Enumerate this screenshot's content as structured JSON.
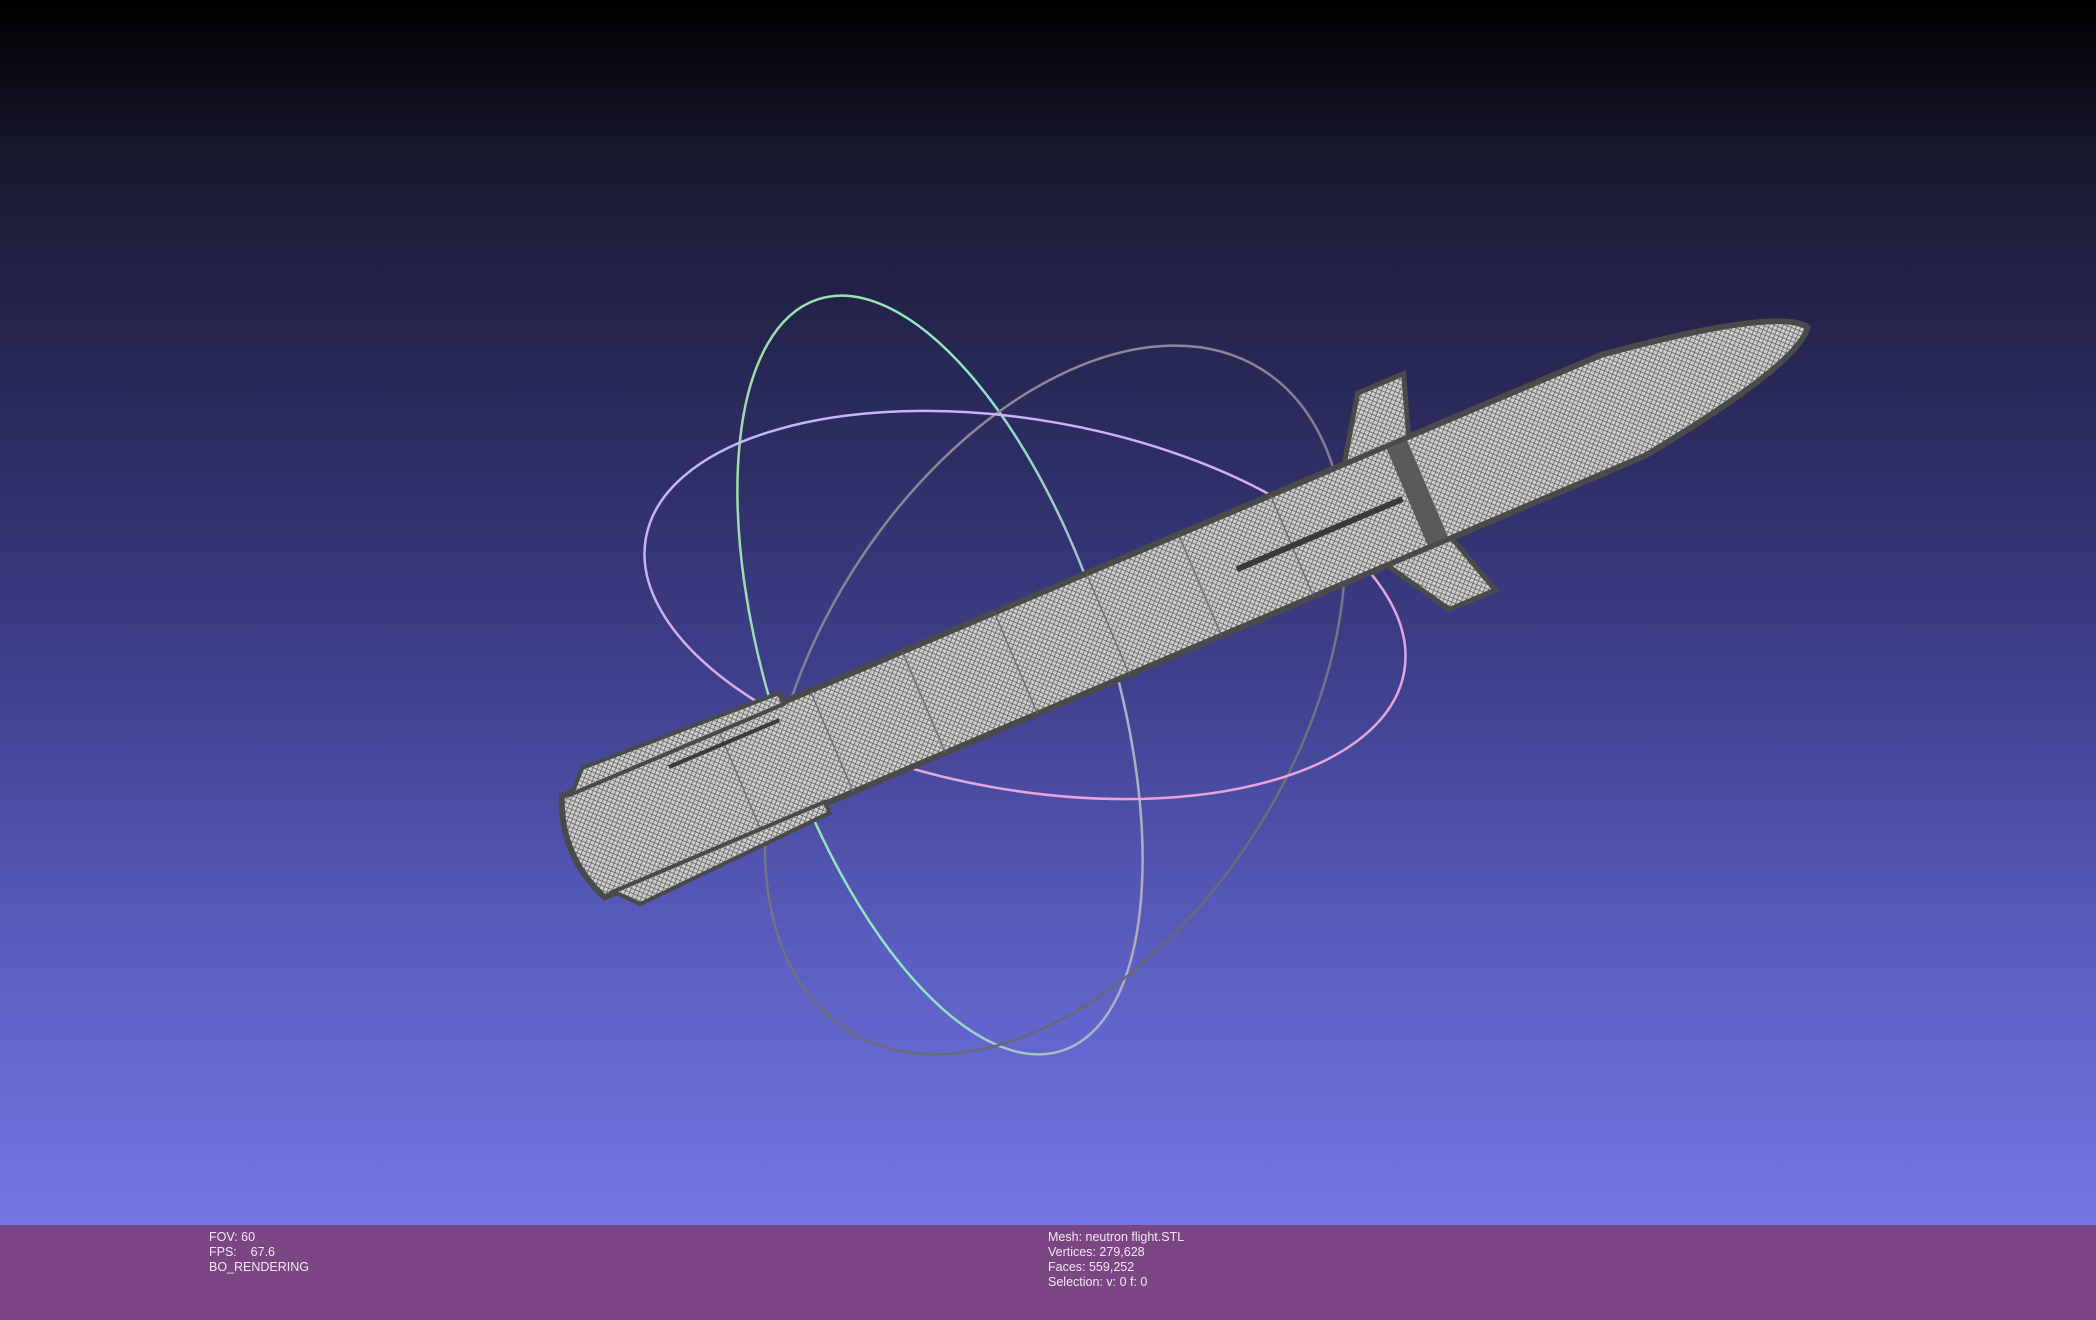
{
  "info_left": {
    "fov": "FOV: 60",
    "fps": "FPS:    67.6",
    "render_mode": "BO_RENDERING"
  },
  "info_right": {
    "mesh": "Mesh: neutron flight.STL",
    "vertices": "Vertices: 279,628",
    "faces": "Faces: 559,252",
    "selection": "Selection: v: 0 f: 0"
  },
  "colors": {
    "info_bar": "#7c4684",
    "wireframe": "#5a5a5a",
    "mesh_fill": "#c8c8c8"
  }
}
